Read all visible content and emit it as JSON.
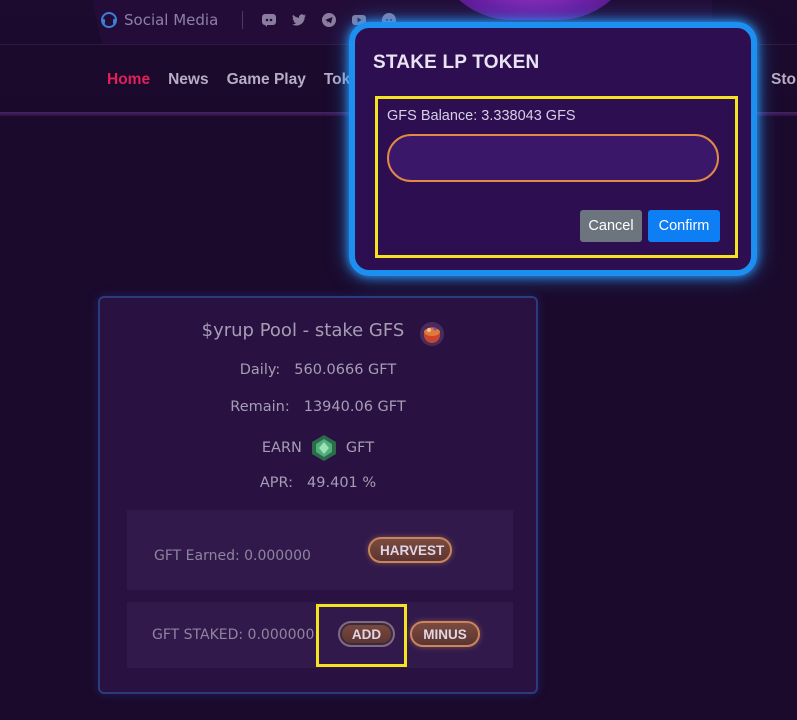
{
  "header": {
    "social_label": "Social Media",
    "social_icons": [
      "discord-icon",
      "twitter-icon",
      "telegram-icon",
      "youtube-icon",
      "reddit-icon"
    ],
    "nav": [
      {
        "label": "Home",
        "active": true
      },
      {
        "label": "News"
      },
      {
        "label": "Game Play"
      },
      {
        "label": "Toke"
      }
    ],
    "nav_right": "Sto"
  },
  "modal": {
    "title": "STAKE LP TOKEN",
    "balance": "GFS Balance: 3.338043 GFS",
    "input_value": "",
    "cancel": "Cancel",
    "confirm": "Confirm"
  },
  "pool": {
    "title": "$yrup Pool - stake GFS",
    "daily_label": "Daily:",
    "daily_value": "560.0666 GFT",
    "remain_label": "Remain:",
    "remain_value": "13940.06 GFT",
    "earn_label": "EARN",
    "earn_token": "GFT",
    "apr_label": "APR:",
    "apr_value": "49.401 %",
    "earned": "GFT Earned: 0.000000",
    "harvest": "HARVEST",
    "staked": "GFT STAKED: 0.000000",
    "add": "ADD",
    "minus": "MINUS"
  },
  "colors": {
    "background": "#1b0a2c",
    "accent_active": "#e0205b",
    "modal_border": "#1d8ff0",
    "highlight": "#f3e320",
    "confirm": "#0d7ef4"
  }
}
